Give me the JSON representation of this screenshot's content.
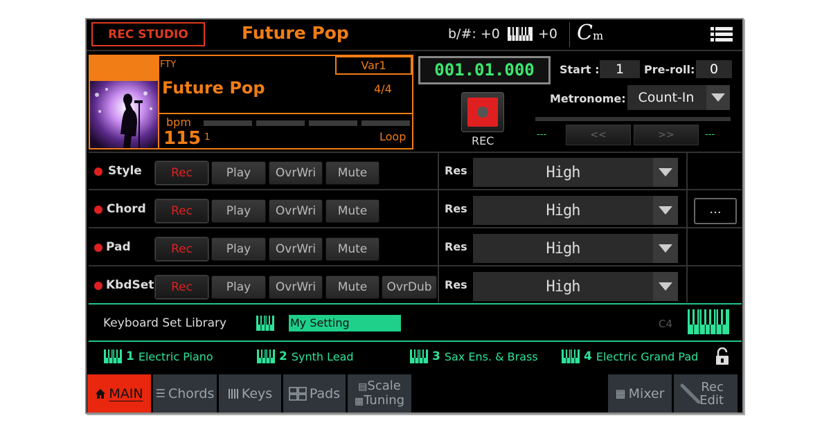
{
  "header": {
    "mode_label": "REC STUDIO",
    "title": "Future Pop",
    "transpose": "b/#: +0",
    "keyboard_transpose": "+0",
    "chord_root": "C",
    "chord_type": "m"
  },
  "song": {
    "bank": "FTY",
    "variation": "Var1",
    "name": "Future Pop",
    "meter": "4/4",
    "bpm_label": "bpm",
    "bpm": "115",
    "measure": "1",
    "loop": "Loop"
  },
  "transport": {
    "counter": "001.01.000",
    "rec_label": "REC",
    "start_label": "Start :",
    "start_value": "1",
    "preroll_label": "Pre-roll:",
    "preroll_value": "0",
    "metronome_label": "Metronome:",
    "metronome_value": "Count-In",
    "left_dash": "---",
    "right_dash": "---",
    "prev_label": "<<",
    "next_label": ">>"
  },
  "tracks": [
    {
      "name": "Style",
      "rec": "Rec",
      "play": "Play",
      "ovrwri": "OvrWri",
      "mute": "Mute",
      "res_label": "Res",
      "res": "High"
    },
    {
      "name": "Chord",
      "rec": "Rec",
      "play": "Play",
      "ovrwri": "OvrWri",
      "mute": "Mute",
      "res_label": "Res",
      "res": "High"
    },
    {
      "name": "Pad",
      "rec": "Rec",
      "play": "Play",
      "ovrwri": "OvrWri",
      "mute": "Mute",
      "res_label": "Res",
      "res": "High"
    },
    {
      "name": "KbdSet",
      "rec": "Rec",
      "play": "Play",
      "ovrwri": "OvrWri",
      "mute": "Mute",
      "ovrdub": "OvrDub",
      "res_label": "Res",
      "res": "High"
    }
  ],
  "more_label": "...",
  "keyboard_set": {
    "label": "Keyboard Set Library",
    "value": "My Setting",
    "octave": "C4"
  },
  "layers": [
    {
      "num": "1",
      "name": "Electric Piano"
    },
    {
      "num": "2",
      "name": "Synth Lead"
    },
    {
      "num": "3",
      "name": "Sax Ens. & Brass"
    },
    {
      "num": "4",
      "name": "Electric Grand Pad"
    }
  ],
  "tabs": {
    "main": "MAIN",
    "chords": "Chords",
    "keys": "Keys",
    "pads": "Pads",
    "scale": "Scale",
    "tuning": "Tuning",
    "mixer": "Mixer",
    "rec": "Rec",
    "edit": "Edit"
  },
  "colors": {
    "accent_orange": "#f07d15",
    "rec_red": "#e02020",
    "green": "#2de39a",
    "counter_green": "#3be86d",
    "active_tab": "#e8270e"
  }
}
